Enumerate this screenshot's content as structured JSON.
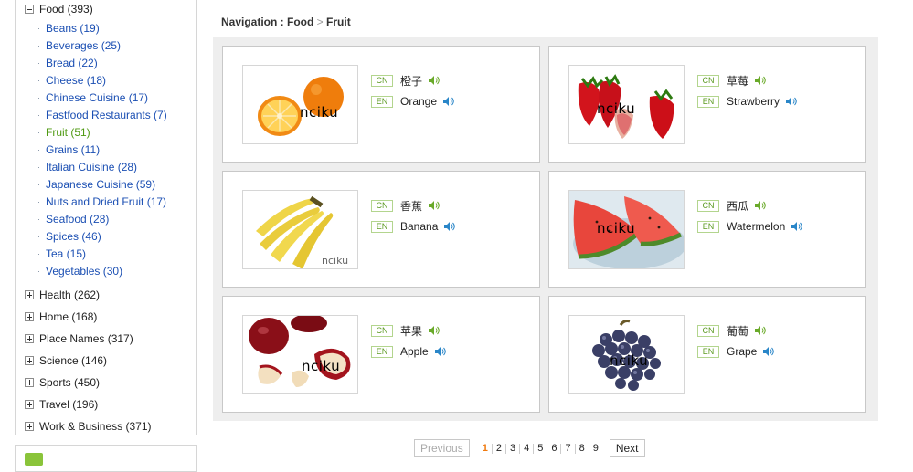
{
  "sidebar": {
    "food": {
      "label": "Food (393)",
      "expanded": true
    },
    "food_items": [
      {
        "label": "Beans (19)"
      },
      {
        "label": "Beverages (25)"
      },
      {
        "label": "Bread (22)"
      },
      {
        "label": "Cheese (18)"
      },
      {
        "label": "Chinese Cuisine (17)"
      },
      {
        "label": "Fastfood Restaurants (7)"
      },
      {
        "label": "Fruit (51)",
        "active": true
      },
      {
        "label": "Grains (11)"
      },
      {
        "label": "Italian Cuisine (28)"
      },
      {
        "label": "Japanese Cuisine (59)"
      },
      {
        "label": "Nuts and Dried Fruit (17)"
      },
      {
        "label": "Seafood (28)"
      },
      {
        "label": "Spices (46)"
      },
      {
        "label": "Tea (15)"
      },
      {
        "label": "Vegetables (30)"
      }
    ],
    "categories": [
      {
        "label": "Health (262)"
      },
      {
        "label": "Home (168)"
      },
      {
        "label": "Place Names (317)"
      },
      {
        "label": "Science (146)"
      },
      {
        "label": "Sports (450)"
      },
      {
        "label": "Travel (196)"
      },
      {
        "label": "Work & Business (371)"
      }
    ],
    "bullet": "·"
  },
  "breadcrumb": {
    "prefix": "Navigation : ",
    "parent": "Food",
    "separator": " > ",
    "current": "Fruit"
  },
  "lang_labels": {
    "cn": "CN",
    "en": "EN"
  },
  "watermark": "nciku",
  "words": [
    {
      "cn": "橙子",
      "en": "Orange"
    },
    {
      "cn": "草莓",
      "en": "Strawberry"
    },
    {
      "cn": "香蕉",
      "en": "Banana"
    },
    {
      "cn": "西瓜",
      "en": "Watermelon"
    },
    {
      "cn": "苹果",
      "en": "Apple"
    },
    {
      "cn": "葡萄",
      "en": "Grape"
    }
  ],
  "icons": {
    "speaker": "speaker-icon",
    "toggle_expanded": "minus-box-icon",
    "toggle_collapsed": "plus-box-icon"
  },
  "colors": {
    "link": "#1b4fb3",
    "active": "#4f9a12",
    "current_page": "#f07a10",
    "tag_border": "#b3d58e"
  },
  "pagination": {
    "previous": "Previous",
    "next": "Next",
    "pages": [
      "1",
      "2",
      "3",
      "4",
      "5",
      "6",
      "7",
      "8",
      "9"
    ],
    "current": "1"
  }
}
